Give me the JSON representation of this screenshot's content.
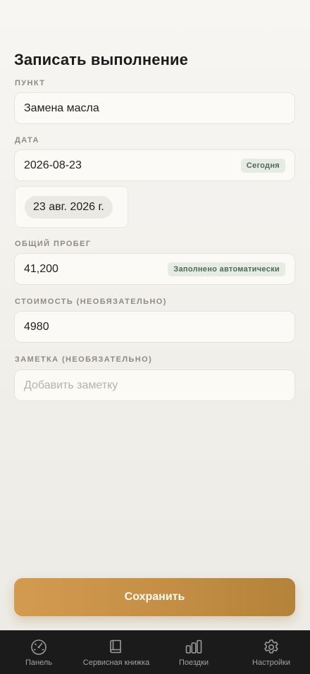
{
  "page": {
    "title": "Записать выполнение"
  },
  "form": {
    "item": {
      "label": "Пункт",
      "value": "Замена масла"
    },
    "date": {
      "label": "Дата",
      "value": "2026-08-23",
      "badge": "Сегодня",
      "picker_value": "23 авг. 2026 г."
    },
    "odometer": {
      "label": "Общий пробег",
      "value": "41,200",
      "badge": "Заполнено автоматически"
    },
    "cost": {
      "label": "Стоимость (необязательно)",
      "value": "4980"
    },
    "note": {
      "label": "Заметка (необязательно)",
      "placeholder": "Добавить заметку"
    }
  },
  "actions": {
    "save_label": "Сохранить"
  },
  "tabbar": {
    "items": [
      {
        "label": "Панель",
        "icon": "gauge-icon"
      },
      {
        "label": "Сервисная книжка",
        "icon": "book-icon"
      },
      {
        "label": "Поездки",
        "icon": "bar-chart-icon"
      },
      {
        "label": "Настройки",
        "icon": "gear-icon"
      }
    ]
  },
  "colors": {
    "accent": "#c48e45",
    "badge_bg": "#e6ebe4",
    "badge_text": "#4f6a58",
    "tabbar_bg": "#1b1b1b"
  }
}
